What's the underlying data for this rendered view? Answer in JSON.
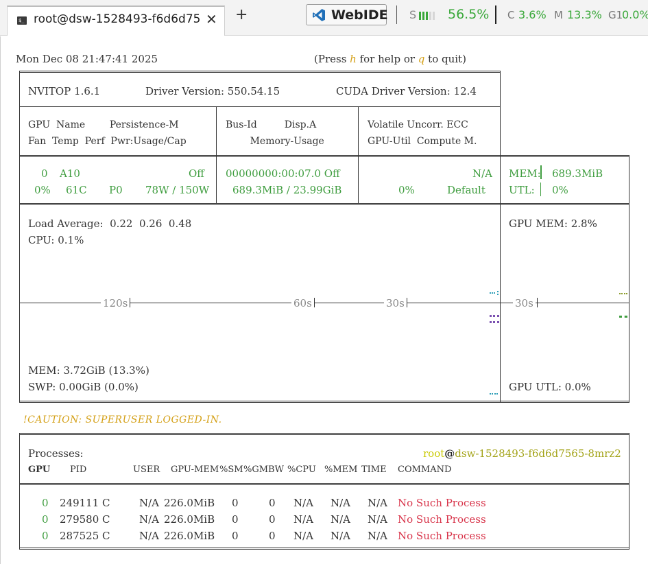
{
  "tab": {
    "icon": "terminal-icon",
    "title": "root@dsw-1528493-f6d6d75",
    "close": "✕",
    "add": "+"
  },
  "toolbar": {
    "webide_label": "WebIDE",
    "stats": {
      "s_label": "S",
      "s_value": "56.5%",
      "s_level": 0.565,
      "c_label": "C",
      "c_value": "3.6%",
      "m_label": "M",
      "m_value": "13.3%",
      "g_label": "G1",
      "g_value": "0.0%"
    }
  },
  "terminal": {
    "datetime": "Mon Dec 08 21:47:41 2025",
    "help_prefix": "(Press ",
    "help_key": "h",
    "help_mid": " for help or ",
    "quit_key": "q",
    "help_suffix": " to quit)",
    "header": {
      "app": "NVITOP 1.6.1",
      "driver": "Driver Version: 550.54.15",
      "cuda": "CUDA Driver Version: 12.4"
    },
    "columns": {
      "c1_line1": "GPU  Name        Persistence-M",
      "c1_line2": "Fan  Temp  Perf  Pwr:Usage/Cap",
      "c2_line1": "Bus-Id         Disp.A",
      "c2_line2": "        Memory-Usage",
      "c3_line1": "Volatile Uncorr. ECC",
      "c3_line2": "GPU-Util  Compute M."
    },
    "gpu": {
      "index": "0",
      "name": "A10",
      "persistence": "Off",
      "fan": "0%",
      "temp": "61C",
      "perf": "P0",
      "power": "78W / 150W",
      "bus_id": "00000000:00:07.0 Off",
      "memory": "689.3MiB / 23.99GiB",
      "ecc": "N/A",
      "util": "0%",
      "compute": "Default",
      "mem_label": "MEM:",
      "mem_value": "689.3MiB",
      "utl_label": "UTL:",
      "utl_value": "0%"
    },
    "host": {
      "load_avg": "Load Average:  0.22  0.26  0.48",
      "cpu": "CPU: 0.1%",
      "mem": "MEM: 3.72GiB (13.3%)",
      "swp": "SWP: 0.00GiB (0.0%)",
      "t120": "120s",
      "t60": "60s",
      "t30": "30s",
      "gpu_mem": "GPU MEM: 2.8%",
      "gpu_t30": "30s",
      "gpu_utl": "GPU UTL: 0.0%"
    },
    "caution": "!CAUTION: SUPERUSER LOGGED-IN.",
    "processes": {
      "title": "Processes:",
      "user": "root",
      "at": "@",
      "host": "dsw-1528493-f6d6d7565-8mrz2",
      "headers": [
        "GPU",
        "PID",
        "USER",
        "GPU-MEM",
        "%SM",
        "%GMBW",
        "%CPU",
        "%MEM",
        "TIME",
        "COMMAND"
      ],
      "rows": [
        {
          "gpu": "0",
          "pid": "249111 C",
          "user": "N/A",
          "gpu_mem": "226.0MiB",
          "sm": "0",
          "gmbw": "0",
          "cpu": "N/A",
          "mem": "N/A",
          "time": "N/A",
          "command": "No Such Process"
        },
        {
          "gpu": "0",
          "pid": "279580 C",
          "user": "N/A",
          "gpu_mem": "226.0MiB",
          "sm": "0",
          "gmbw": "0",
          "cpu": "N/A",
          "mem": "N/A",
          "time": "N/A",
          "command": "No Such Process"
        },
        {
          "gpu": "0",
          "pid": "287525 C",
          "user": "N/A",
          "gpu_mem": "226.0MiB",
          "sm": "0",
          "gmbw": "0",
          "cpu": "N/A",
          "mem": "N/A",
          "time": "N/A",
          "command": "No Such Process"
        }
      ]
    }
  },
  "colors": {
    "green": "#3f9d3f",
    "red": "#d8344a",
    "yellow": "#c9c900",
    "stat_green": "#3aa83a",
    "caution": "#d4a017"
  }
}
